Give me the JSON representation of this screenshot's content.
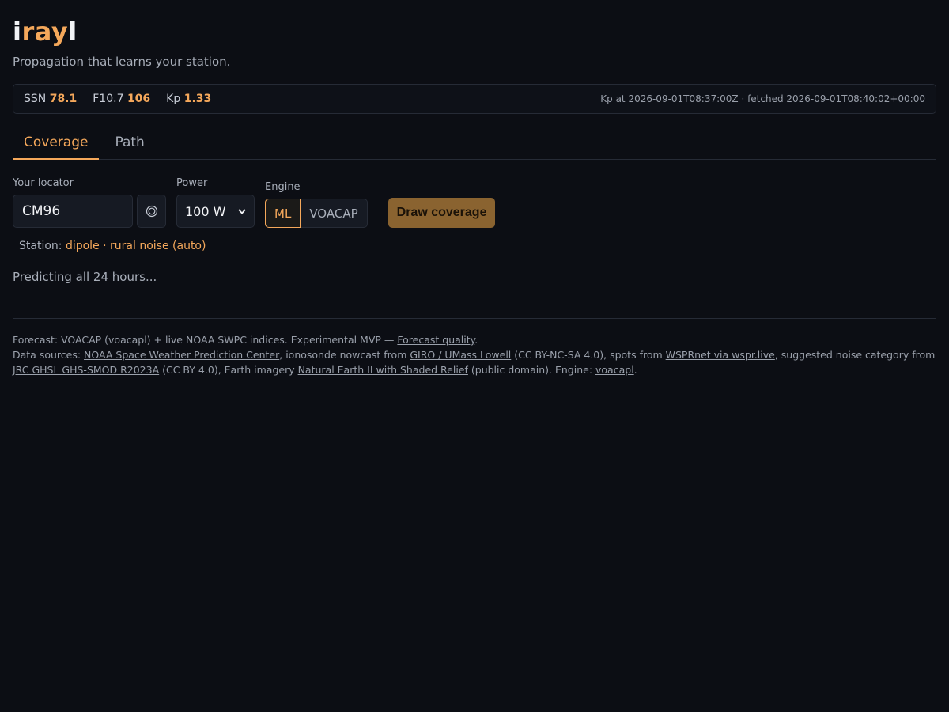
{
  "brand": {
    "part1": "i",
    "part2": "ray",
    "part3": "l"
  },
  "tagline": "Propagation that learns your station.",
  "indices": {
    "ssn_label": "SSN",
    "ssn_value": "78.1",
    "f107_label": "F10.7",
    "f107_value": "106",
    "kp_label": "Kp",
    "kp_value": "1.33",
    "meta": "Kp at 2026-09-01T08:37:00Z · fetched 2026-09-01T08:40:02+00:00"
  },
  "tabs": [
    {
      "label": "Coverage",
      "active": true
    },
    {
      "label": "Path",
      "active": false
    }
  ],
  "form": {
    "locator_label": "Your locator",
    "locator_value": "CM96",
    "power_label": "Power",
    "power_value": "100 W",
    "engine_label": "Engine",
    "engine_options": [
      "ML",
      "VOACAP"
    ],
    "engine_selected": "ML",
    "draw_label": "Draw coverage"
  },
  "station": {
    "label": "Station:",
    "value": "dipole · rural noise (auto)"
  },
  "status": "Predicting all 24 hours...",
  "footer": {
    "line1_pre": "Forecast: VOACAP (voacapl) + live NOAA SWPC indices. Experimental MVP — ",
    "line1_link": "Forecast quality",
    "line1_post": ".",
    "ds_pre": "Data sources: ",
    "link_noaa": "NOAA Space Weather Prediction Center",
    "t1": ", ionosonde nowcast from ",
    "link_giro": "GIRO / UMass Lowell",
    "t2": " (CC BY-NC-SA 4.0), spots from ",
    "link_wspr": "WSPRnet via wspr.live",
    "t3": ", suggested noise category from ",
    "link_jrc": "JRC GHSL GHS-SMOD R2023A",
    "t4": " (CC BY 4.0), Earth imagery ",
    "link_ne": "Natural Earth II with Shaded Relief",
    "t5": " (public domain). Engine: ",
    "link_voacapl": "voacapl",
    "t6": "."
  },
  "colors": {
    "accent": "#f5a85b",
    "background": "#0c0e14",
    "button": "#8a6330"
  }
}
